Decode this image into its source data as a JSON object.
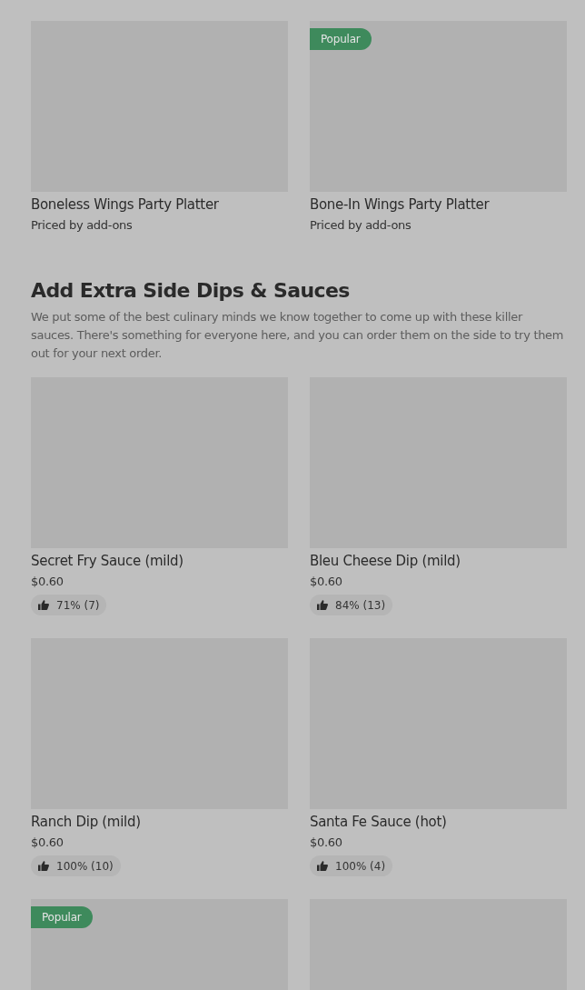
{
  "sections": [
    {
      "items": [
        {
          "name": "Boneless Wings Party Platter",
          "subtitle": "Priced by add-ons",
          "popular": false
        },
        {
          "name": "Bone-In Wings Party Platter",
          "subtitle": "Priced by add-ons",
          "popular": true,
          "badge": "Popular"
        }
      ]
    },
    {
      "title": "Add Extra Side Dips & Sauces",
      "description": "We put some of the best culinary minds we know together to come up with these killer sauces. There's something for everyone here, and you can order them on the side to try them out for your next order.",
      "items": [
        {
          "name": "Secret Fry Sauce (mild)",
          "price": "$0.60",
          "rating": "71% (7)",
          "popular": false
        },
        {
          "name": "Bleu Cheese Dip (mild)",
          "price": "$0.60",
          "rating": "84% (13)",
          "popular": false
        },
        {
          "name": "Ranch Dip (mild)",
          "price": "$0.60",
          "rating": "100% (10)",
          "popular": false
        },
        {
          "name": "Santa Fe Sauce (hot)",
          "price": "$0.60",
          "rating": "100% (4)",
          "popular": false
        },
        {
          "popular": true,
          "badge": "Popular"
        },
        {
          "popular": false
        }
      ]
    }
  ]
}
